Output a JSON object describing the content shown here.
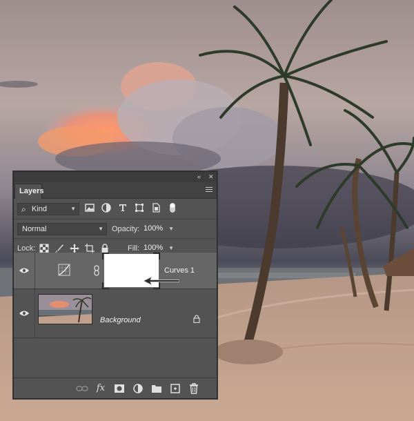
{
  "panel": {
    "tab_label": "Layers",
    "collapse_glyph": "«",
    "close_glyph": "✕",
    "filter": {
      "kind_label": "Kind",
      "search_glyph": "⌕",
      "icons": [
        "image-filter-icon",
        "adjustment-filter-icon",
        "type-filter-icon",
        "shape-filter-icon",
        "smart-object-filter-icon",
        "filter-toggle-icon"
      ]
    },
    "blend": {
      "mode": "Normal",
      "opacity_label": "Opacity:",
      "opacity_value": "100%"
    },
    "lock": {
      "label": "Lock:",
      "fill_label": "Fill:",
      "fill_value": "100%",
      "icons": [
        "lock-transparent-icon",
        "lock-image-icon",
        "lock-position-icon",
        "lock-artboard-icon",
        "lock-all-icon"
      ]
    },
    "layers": [
      {
        "name": "Curves 1",
        "type": "adjustment",
        "visible": true,
        "selected": true
      },
      {
        "name": "Background",
        "type": "pixel",
        "visible": true,
        "locked": true
      }
    ],
    "bottom_icons": [
      "link-layers-icon",
      "fx-icon",
      "add-mask-icon",
      "new-adjustment-icon",
      "new-group-icon",
      "new-layer-icon",
      "trash-icon"
    ],
    "fx_label": "fx"
  },
  "colors": {
    "panel_bg": "#535353",
    "selected_row": "#666666",
    "arrow": "#2d2d2d"
  }
}
